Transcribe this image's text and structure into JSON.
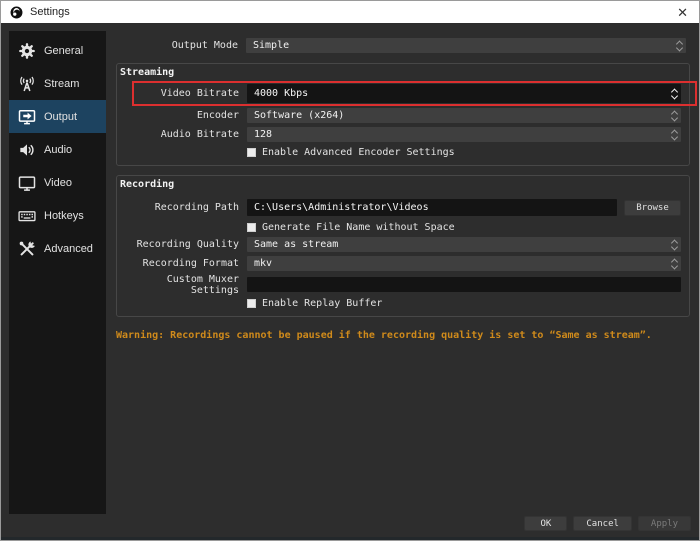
{
  "window": {
    "title": "Settings",
    "close_glyph": "✕"
  },
  "sidebar": {
    "selected": "Output",
    "items": [
      {
        "label": "General",
        "icon": "gear-icon"
      },
      {
        "label": "Stream",
        "icon": "antenna-icon"
      },
      {
        "label": "Output",
        "icon": "monitor-arrow-icon"
      },
      {
        "label": "Audio",
        "icon": "speaker-icon"
      },
      {
        "label": "Video",
        "icon": "monitor-icon"
      },
      {
        "label": "Hotkeys",
        "icon": "keyboard-icon"
      },
      {
        "label": "Advanced",
        "icon": "tools-icon"
      }
    ]
  },
  "output_mode": {
    "label": "Output Mode",
    "value": "Simple"
  },
  "streaming": {
    "title": "Streaming",
    "video_bitrate": {
      "label": "Video Bitrate",
      "value": "4000 Kbps",
      "highlighted": true
    },
    "encoder": {
      "label": "Encoder",
      "value": "Software (x264)"
    },
    "audio_bitrate": {
      "label": "Audio Bitrate",
      "value": "128"
    },
    "advanced_checkbox": {
      "label": "Enable Advanced Encoder Settings",
      "checked": false
    }
  },
  "recording": {
    "title": "Recording",
    "path": {
      "label": "Recording Path",
      "value": "C:\\Users\\Administrator\\Videos",
      "browse_label": "Browse"
    },
    "filename_checkbox": {
      "label": "Generate File Name without Space",
      "checked": false
    },
    "quality": {
      "label": "Recording Quality",
      "value": "Same as stream"
    },
    "format": {
      "label": "Recording Format",
      "value": "mkv"
    },
    "muxer": {
      "label": "Custom Muxer Settings",
      "value": ""
    },
    "replay_checkbox": {
      "label": "Enable Replay Buffer",
      "checked": false
    }
  },
  "warning": {
    "text": "Warning: Recordings cannot be paused if the recording quality is set to “Same as stream”."
  },
  "buttons": {
    "ok": "OK",
    "cancel": "Cancel",
    "apply": "Apply"
  },
  "colors": {
    "annotation_red": "#dc2f2f",
    "selected_blue": "#1d4360",
    "warning_orange": "#cf8a1b",
    "sidebar_bg": "#161616",
    "window_bg": "#2d2d2d"
  }
}
